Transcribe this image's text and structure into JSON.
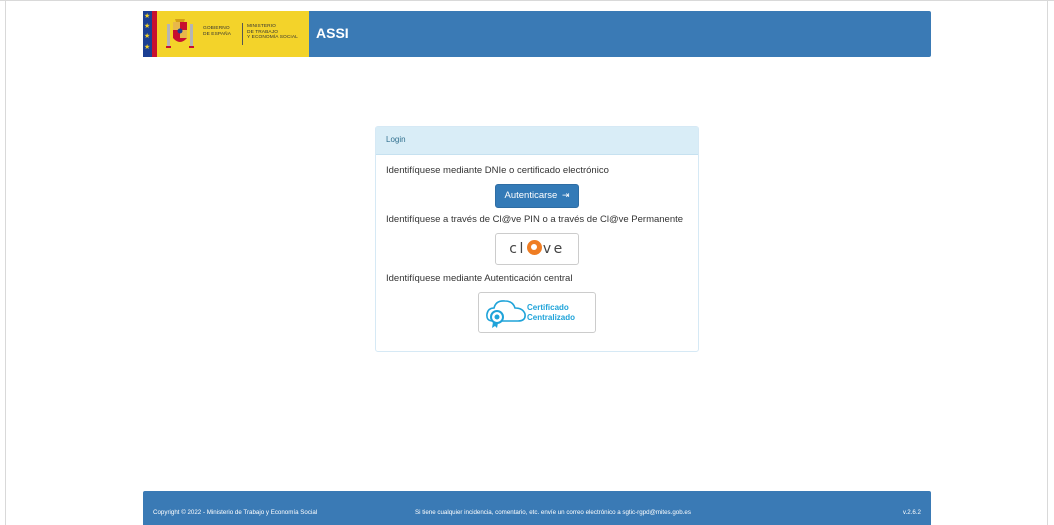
{
  "header": {
    "app_title": "ASSI",
    "logo_gov_line1": "GOBIERNO",
    "logo_gov_line2": "DE ESPAÑA",
    "logo_min_line1": "MINISTERIO",
    "logo_min_line2": "DE TRABAJO",
    "logo_min_line3": "Y ECONOMÍA SOCIAL",
    "color": "#3a7ab5"
  },
  "login": {
    "heading": "Login",
    "dnie_prompt": "Identifíquese mediante DNIe o certificado electrónico",
    "auth_button_label": "Autenticarse",
    "clave_prompt": "Identifíquese a través de Cl@ve PIN o a través de Cl@ve Permanente",
    "clave_logo_left": "cl",
    "clave_logo_right": "ve",
    "central_prompt": "Identifíquese mediante Autenticación central",
    "cert_line1": "Certificado",
    "cert_line2": "Centralizado"
  },
  "footer": {
    "copyright": "Copyright © 2022 - Ministerio de Trabajo y Economía Social",
    "contact": "Si tiene cualquier incidencia, comentario, etc. envíe un correo electrónico a sgtic-rgpd@mites.gob.es",
    "version": "v.2.6.2"
  },
  "icons": {
    "login_arrow": "sign-in-icon",
    "cert": "cloud-certificate-icon",
    "coat_of_arms": "coat-of-arms-icon"
  }
}
